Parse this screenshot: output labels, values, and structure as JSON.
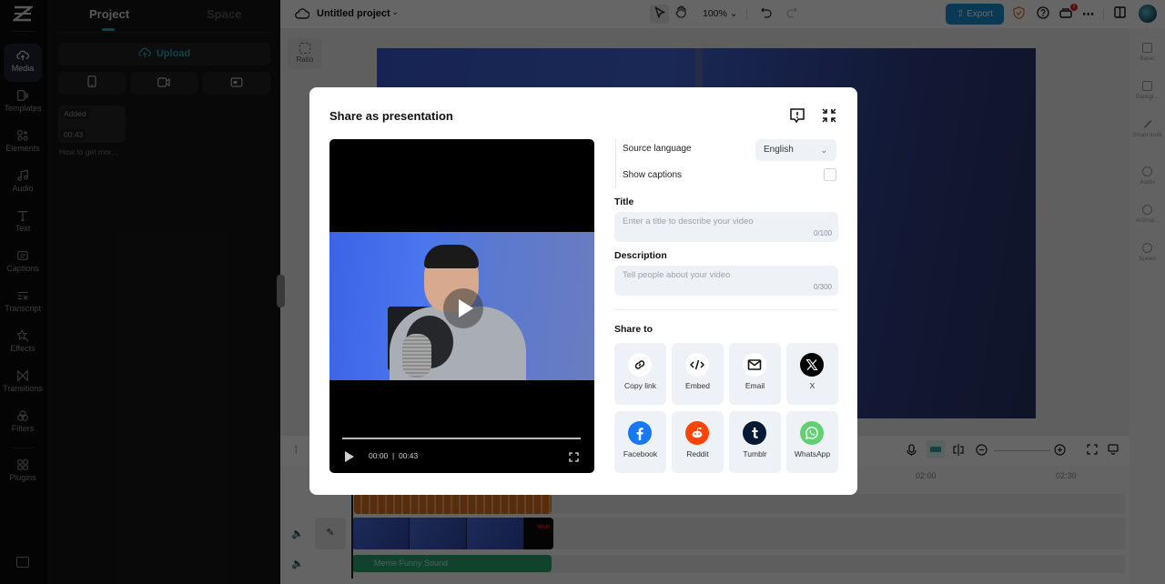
{
  "app": {
    "logo": "capcut-logo"
  },
  "rail": {
    "items": [
      {
        "label": "Media",
        "icon": "cloud-upload-icon",
        "active": true
      },
      {
        "label": "Templates",
        "icon": "templates-icon"
      },
      {
        "label": "Elements",
        "icon": "elements-icon"
      },
      {
        "label": "Audio",
        "icon": "music-note-icon"
      },
      {
        "label": "Text",
        "icon": "text-icon"
      },
      {
        "label": "Captions",
        "icon": "captions-icon"
      },
      {
        "label": "Transcript",
        "icon": "transcript-icon"
      },
      {
        "label": "Effects",
        "icon": "effects-icon"
      },
      {
        "label": "Transitions",
        "icon": "transitions-icon"
      },
      {
        "label": "Filters",
        "icon": "filters-icon"
      },
      {
        "label": "Plugins",
        "icon": "plugins-icon"
      }
    ]
  },
  "media_panel": {
    "tabs": [
      {
        "label": "Project",
        "active": true
      },
      {
        "label": "Space"
      }
    ],
    "upload_label": "Upload",
    "sources": [
      "phone-icon",
      "camera-icon",
      "screen-record-icon"
    ],
    "items": [
      {
        "badge": "Added",
        "duration": "00:43",
        "name": "How to get mor..."
      }
    ]
  },
  "topbar": {
    "project_title": "Untitled project",
    "zoom": "100%",
    "export_label": "Export",
    "notification_count": "!"
  },
  "canvas": {
    "ratio_label": "Ratio"
  },
  "right_sidebar": {
    "items": [
      "Basic",
      "Backgr...",
      "Smart tools",
      "Audio",
      "Animat...",
      "Speed"
    ]
  },
  "timeline": {
    "ruler": [
      "02:00",
      "02:30"
    ],
    "audio_clip_name": "Meme Funny Sound",
    "clip_overlay_text": "WAR"
  },
  "modal": {
    "title": "Share as presentation",
    "video": {
      "current_time": "00:00",
      "separator": "|",
      "duration": "00:43",
      "progress": 0
    },
    "source_language_label": "Source language",
    "source_language_value": "English",
    "show_captions_label": "Show captions",
    "show_captions_checked": false,
    "title_label": "Title",
    "title_placeholder": "Enter a title to describe your video",
    "title_counter": "0/100",
    "description_label": "Description",
    "description_placeholder": "Tell people about your video",
    "description_counter": "0/300",
    "share_to_label": "Share to",
    "share_targets": [
      {
        "label": "Copy link",
        "icon": "link-icon"
      },
      {
        "label": "Embed",
        "icon": "code-icon"
      },
      {
        "label": "Email",
        "icon": "email-icon"
      },
      {
        "label": "X",
        "icon": "x-logo-icon",
        "color": "#000000"
      },
      {
        "label": "Facebook",
        "icon": "facebook-icon",
        "color": "#1877F2"
      },
      {
        "label": "Reddit",
        "icon": "reddit-icon",
        "color": "#FF4500"
      },
      {
        "label": "Tumblr",
        "icon": "tumblr-icon",
        "color": "#001935"
      },
      {
        "label": "WhatsApp",
        "icon": "whatsapp-icon",
        "color": "#5FD173"
      }
    ]
  },
  "colors": {
    "accent": "#2AA7B0",
    "export": "#1A8FD8",
    "waveform": "#D67322",
    "audio_clip": "#2AA874"
  }
}
